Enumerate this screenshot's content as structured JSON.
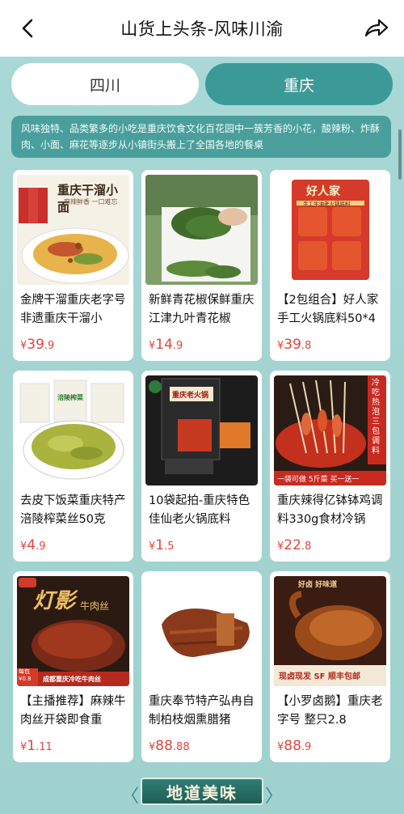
{
  "header": {
    "title": "山货上头条-风味川渝"
  },
  "tabs": [
    {
      "label": "四川"
    },
    {
      "label": "重庆"
    }
  ],
  "description": "风味独特、品类繁多的小吃是重庆饮食文化百花园中一簇芳香的小花，酸辣粉、炸酥肉、小面、麻花等逐步从小镇街头搬上了全国各地的餐桌",
  "products": [
    {
      "name": "金牌干溜重庆老字号非遗重庆干溜小",
      "price_int": "39",
      "price_dec": ".9",
      "image_text": "重庆干溜小面",
      "image_sub": "麻辣鲜香 一口难忘"
    },
    {
      "name": "新鲜青花椒保鲜重庆江津九叶青花椒",
      "price_int": "14",
      "price_dec": ".9"
    },
    {
      "name": "【2包组合】好人家手工火锅底料50*4",
      "price_int": "39",
      "price_dec": ".8",
      "image_text": "好人家",
      "image_sub": "手工牛油老火锅底料"
    },
    {
      "name": "去皮下饭菜重庆特产涪陵榨菜丝50克",
      "price_int": "4",
      "price_dec": ".9",
      "image_text": "涪陵榨菜"
    },
    {
      "name": "10袋起拍-重庆特色佳仙老火锅底料",
      "price_int": "1",
      "price_dec": ".5",
      "image_text": "重庆老火锅"
    },
    {
      "name": "重庆辣得亿钵钵鸡调料330g食材冷锅",
      "price_int": "22",
      "price_dec": ".8",
      "image_text": "冷吃热泡三包调料",
      "image_sub": "一袋可做 5斤菜 买一送一"
    },
    {
      "name": "【主播推荐】麻辣牛肉丝开袋即食重",
      "price_int": "1",
      "price_dec": ".11",
      "image_text": "灯影",
      "image_sub": "牛肉丝",
      "image_tag": "每包 ¥0.8",
      "image_foot": "成都重庆冷吃牛肉丝"
    },
    {
      "name": "重庆奉节特产弘冉自制柏枝烟熏腊猪",
      "price_int": "88",
      "price_dec": ".88"
    },
    {
      "name": "【小罗卤鹅】重庆老字号 整只2.8",
      "price_int": "88",
      "price_dec": ".9",
      "image_text": "好卤 好味道",
      "image_sub": "现卤现发 SF 顺丰包邮"
    }
  ],
  "price_symbol": "¥",
  "banner": {
    "label": "地道美味",
    "left_arrow": "〈",
    "right_arrow": "〉"
  },
  "colors": {
    "teal_bg": "#a9d8d6",
    "active_tab": "#3b9a98",
    "price_red": "#e0453d"
  }
}
